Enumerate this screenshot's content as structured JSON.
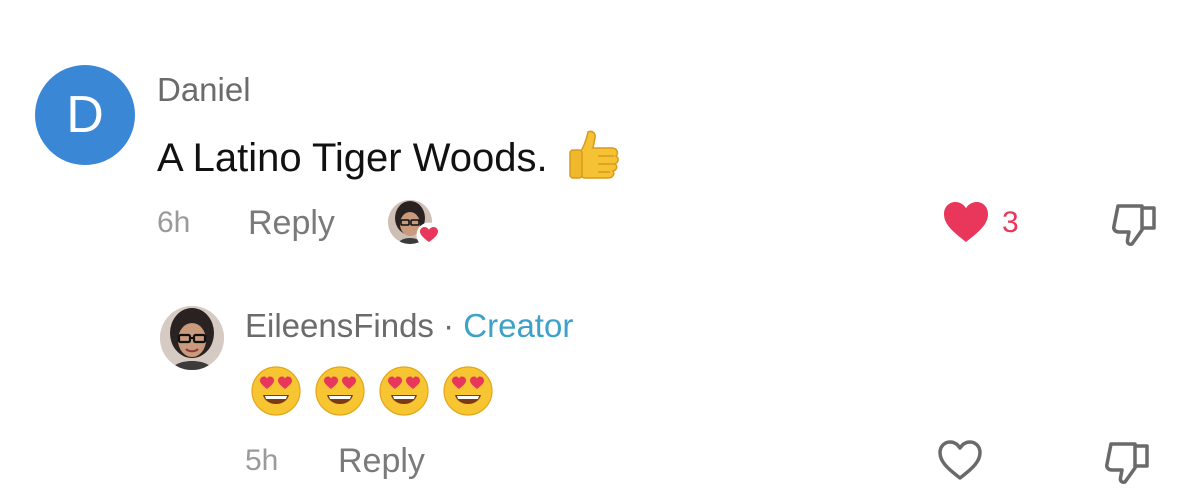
{
  "comment": {
    "avatar_letter": "D",
    "username": "Daniel",
    "text": "A Latino Tiger Woods.",
    "emoji": "thumbs-up-icon",
    "time": "6h",
    "reply_label": "Reply",
    "creator_liked": true,
    "like_count": "3",
    "liked": true
  },
  "reply": {
    "username": "EileensFinds",
    "separator": "·",
    "badge": "Creator",
    "emojis": [
      "heart-eyes-icon",
      "heart-eyes-icon",
      "heart-eyes-icon",
      "heart-eyes-icon"
    ],
    "time": "5h",
    "reply_label": "Reply",
    "liked": false
  },
  "colors": {
    "avatar_bg": "#3a87d6",
    "like_red": "#e8375a",
    "creator_blue": "#3ea2c8",
    "meta_gray": "#9a9a9a"
  }
}
